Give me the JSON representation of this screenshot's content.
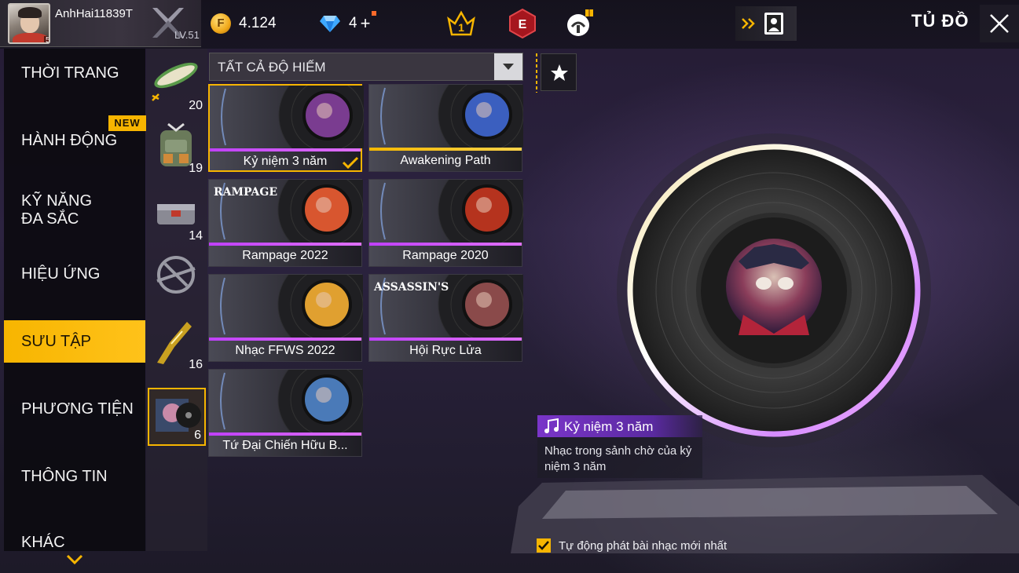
{
  "player": {
    "name": "AnhHai11839T",
    "avatar_level": "51",
    "level_label": "LV.51"
  },
  "currencies": {
    "gold": "4.124",
    "diamonds": "4",
    "diamonds_plus": "+"
  },
  "top_icons": {
    "rank_number": "1",
    "elite_letter": "E"
  },
  "header": {
    "title": "TỦ ĐỒ"
  },
  "categories": [
    {
      "label": "THỜI TRANG"
    },
    {
      "label": "HÀNH ĐỘNG",
      "badge": "NEW"
    },
    {
      "label": "KỸ NĂNG ĐA SẮC"
    },
    {
      "label": "HIỆU ỨNG"
    },
    {
      "label": "SƯU TẬP",
      "active": true
    },
    {
      "label": "PHƯƠNG TIỆN"
    },
    {
      "label": "THÔNG TIN"
    },
    {
      "label": "KHÁC"
    }
  ],
  "subcategories": [
    {
      "icon": "surfboard-icon",
      "count": "20"
    },
    {
      "icon": "backpack-icon",
      "count": "19"
    },
    {
      "icon": "loot-box-icon",
      "count": "14"
    },
    {
      "icon": "parachute-icon",
      "count": ""
    },
    {
      "icon": "weapon-skin-icon",
      "count": "16"
    },
    {
      "icon": "music-album-icon",
      "count": "6",
      "active": true
    }
  ],
  "filter": {
    "label": "TẤT CẢ ĐỘ HIẾM"
  },
  "items": [
    {
      "name": "Kỷ niệm 3 năm",
      "selected": true,
      "owned": true,
      "bar": "purple",
      "art": "#7a3c90"
    },
    {
      "name": "Awakening Path",
      "bar": "gold",
      "art": "#3b5fbf"
    },
    {
      "name": "Rampage 2022",
      "bar": "purple",
      "art": "#d8562f",
      "brand": "RAMPAGE"
    },
    {
      "name": "Rampage 2020",
      "bar": "purple",
      "art": "#b5331e"
    },
    {
      "name": "Nhạc FFWS 2022",
      "bar": "purple",
      "art": "#e0a030"
    },
    {
      "name": "Hội Rực Lửa",
      "bar": "purple",
      "art": "#8a4a4a",
      "brand": "ASSASSIN'S"
    },
    {
      "name": "Tứ Đại Chiến Hữu B...",
      "bar": "purple",
      "art": "#4a7ab8"
    }
  ],
  "preview": {
    "title": "Kỷ niệm 3 năm",
    "description": "Nhạc trong sảnh chờ của kỷ niệm 3 năm"
  },
  "autoplay": {
    "label": "Tự động phát bài nhạc mới nhất",
    "checked": true
  },
  "colors": {
    "accent": "#f7b500",
    "rarity_purple": "#c040ff",
    "rarity_gold": "#f5b800"
  }
}
